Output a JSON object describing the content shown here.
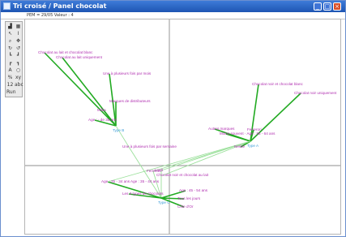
{
  "window": {
    "title": "Tri croisé / Panel chocolat",
    "subtitle": "PEM = 29/05 Valeur : 4",
    "buttons": {
      "minimize": "_",
      "maximize": "□",
      "close": "×"
    }
  },
  "toolbox": {
    "tools": [
      {
        "icon": "bar-chart-icon",
        "glyph": "▟"
      },
      {
        "icon": "grid-icon",
        "glyph": "▦"
      },
      {
        "icon": "pointer-icon",
        "glyph": "↖"
      },
      {
        "icon": "text-cursor-icon",
        "glyph": "I"
      },
      {
        "icon": "zoom-in-icon",
        "glyph": "⌕"
      },
      {
        "icon": "pan-icon",
        "glyph": "✥"
      },
      {
        "icon": "rotate-icon",
        "glyph": "↻"
      },
      {
        "icon": "rotate-alt-icon",
        "glyph": "↺"
      },
      {
        "icon": "axis-icon",
        "glyph": "┗"
      },
      {
        "icon": "axis-alt-icon",
        "glyph": "┛"
      },
      {
        "icon": "axis-both-icon",
        "glyph": "┏"
      },
      {
        "icon": "axis-cross-icon",
        "glyph": "┓"
      },
      {
        "icon": "label-icon",
        "glyph": "A"
      },
      {
        "icon": "circle-icon",
        "glyph": "○"
      },
      {
        "icon": "percent-icon",
        "glyph": "%"
      },
      {
        "icon": "xy-icon",
        "glyph": "xy"
      },
      {
        "icon": "number-icon",
        "glyph": "12"
      },
      {
        "icon": "abc-icon",
        "glyph": "abc"
      },
      {
        "icon": "run-icon",
        "glyph": "Run"
      }
    ]
  },
  "colors": {
    "label": "#b030b0",
    "type": "#3a9cd8",
    "link_dark": "#22aa22",
    "link_light": "#9be09b",
    "axis": "#6a6a6a"
  },
  "map": {
    "labels": [
      {
        "name": "chocolat-lait-blanc",
        "text": "Chocolat au lait et chocolat blanc"
      },
      {
        "name": "chocolat-lait-uniquement",
        "text": "Chocolat au lait uniquement"
      },
      {
        "name": "plusieurs-fois-par-mois",
        "text": "Une à plusieurs fois par mois"
      },
      {
        "name": "marques-distributeurs",
        "text": "Marques de distributeurs"
      },
      {
        "name": "milka",
        "text": "Milka"
      },
      {
        "name": "age-35-ans",
        "text": "Age : - de 35 ans"
      },
      {
        "name": "plusieurs-fois-par-semaine",
        "text": "Une à plusieurs fois par semaine"
      },
      {
        "name": "chocolat-noir-blanc",
        "text": "Chocolat noir et chocolat blanc"
      },
      {
        "name": "chocolat-noir-uniquement",
        "text": "Chocolat noir uniquement"
      },
      {
        "name": "autres-marques",
        "text": "Autres marques"
      },
      {
        "name": "ferrerori",
        "text": "Ferrerori"
      },
      {
        "name": "moins-souvent-age-55-64",
        "text": "Moins souvent · Age : 55 - 64 ans"
      },
      {
        "name": "nestle",
        "text": "Nestlé"
      },
      {
        "name": "lindt",
        "text": "Lindt"
      },
      {
        "name": "ferrerori-2",
        "text": "Ferrerori"
      },
      {
        "name": "chocolat-noir-et-lait",
        "text": "Chocolat noir et chocolat au lait"
      },
      {
        "name": "age-25-34-45-44",
        "text": "Age : 25 - 34 ans Age : 35 - 44 ans"
      },
      {
        "name": "age-45-54",
        "text": "Age : 45 - 54 ans"
      },
      {
        "name": "trois-types",
        "text": "Les 3 types de chocolats"
      },
      {
        "name": "tous-les-jours",
        "text": "Tous les jours"
      },
      {
        "name": "cote-dor",
        "text": "Côte d'Or"
      }
    ],
    "types": [
      {
        "name": "type-b",
        "text": "Type B"
      },
      {
        "name": "type-a",
        "text": "Type A"
      },
      {
        "name": "type-c",
        "text": "Type C"
      }
    ]
  }
}
